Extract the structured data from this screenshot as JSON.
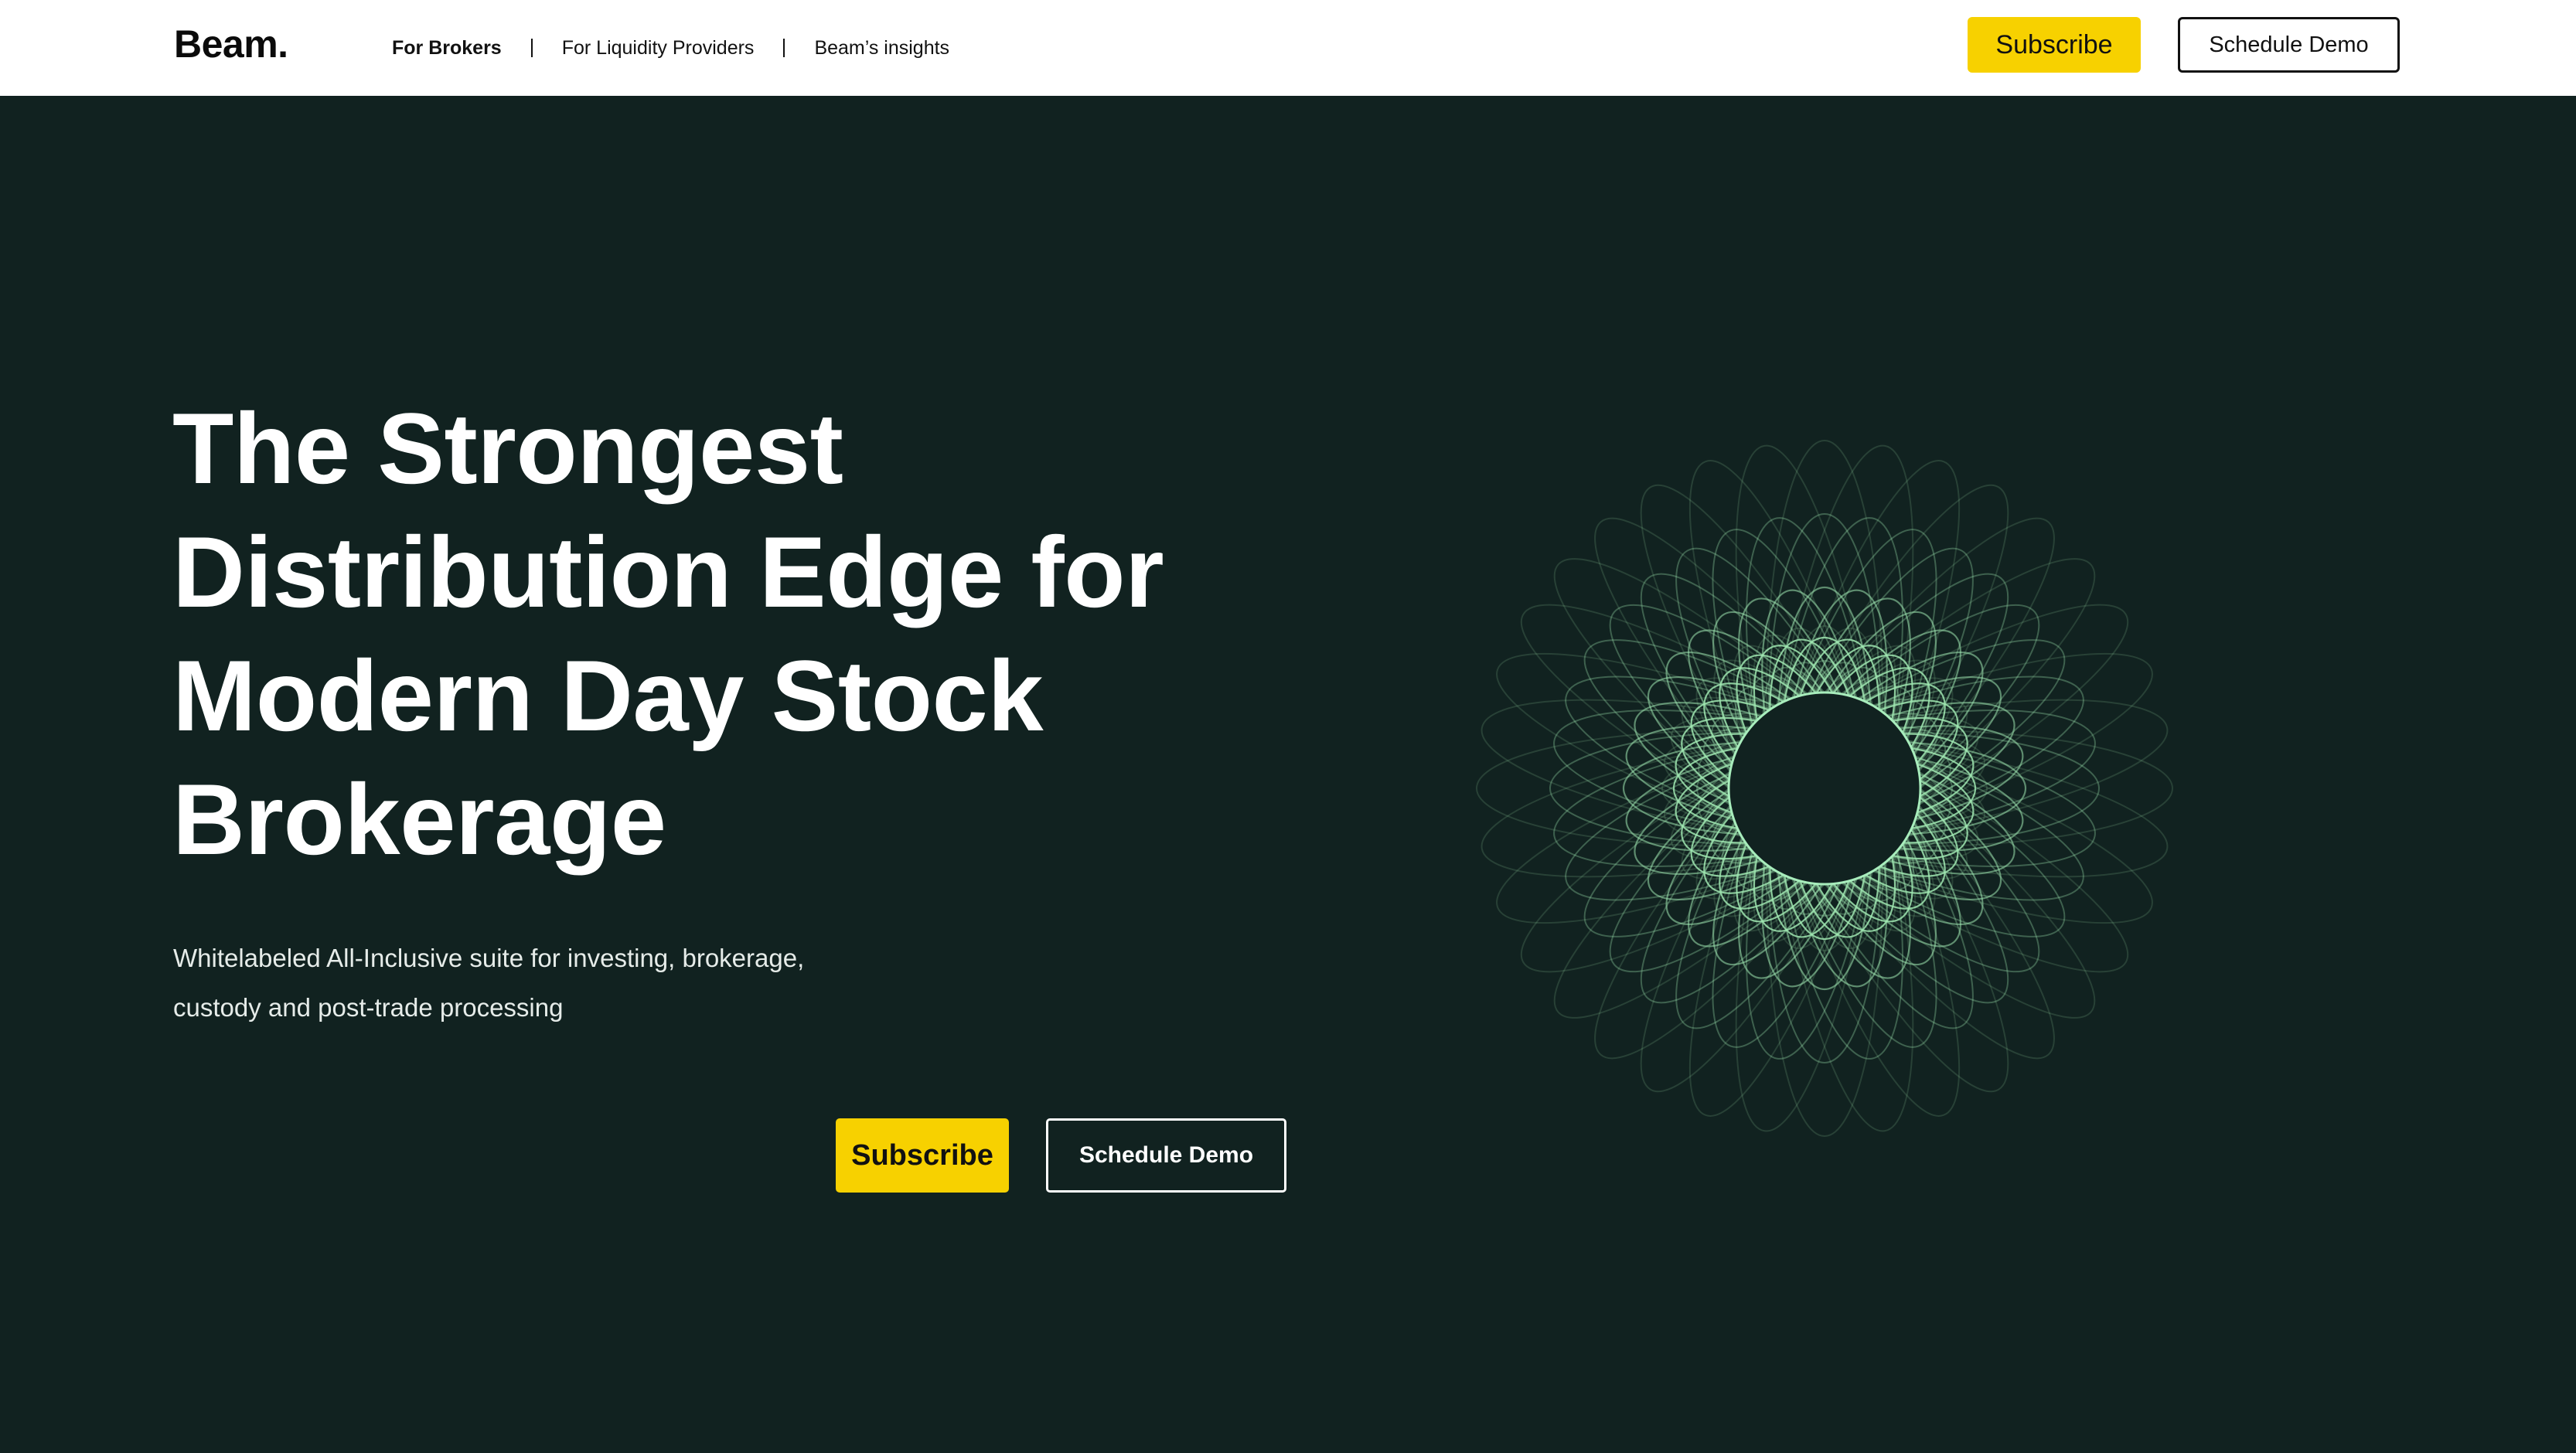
{
  "nav": {
    "logo": "Beam.",
    "links": [
      {
        "label": "For Brokers",
        "active": true
      },
      {
        "label": "For Liquidity Providers",
        "active": false
      },
      {
        "label": "Beam’s insights",
        "active": false
      }
    ],
    "subscribe_label": "Subscribe",
    "demo_label": "Schedule Demo"
  },
  "hero": {
    "title_lines": [
      "The Strongest",
      "Distribution Edge for",
      "Modern Day Stock",
      "Brokerage"
    ],
    "subtitle_lines": [
      "Whitelabeled All-Inclusive suite for investing, brokerage,",
      "custody and post-trade processing"
    ],
    "subscribe_label": "Subscribe",
    "demo_label": "Schedule Demo"
  },
  "colors": {
    "background": "#112220",
    "accent_yellow": "#f7d100",
    "graphic_green": "#9fe6b0"
  },
  "graphic": {
    "name": "spirograph-flower-graphic"
  }
}
